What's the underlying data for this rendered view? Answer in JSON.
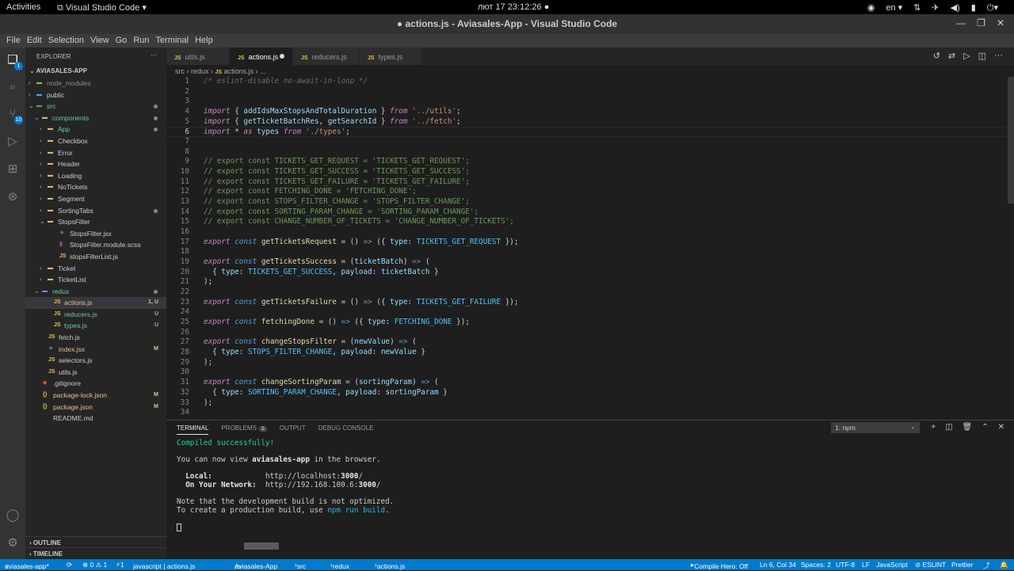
{
  "topbar": {
    "activities": "Activities",
    "app": "Visual Studio Code",
    "clock": "лют 17  23:12:26",
    "lang": "en"
  },
  "window": {
    "title": "● actions.js - Aviasales-App - Visual Studio Code"
  },
  "menu": [
    "File",
    "Edit",
    "Selection",
    "View",
    "Go",
    "Run",
    "Terminal",
    "Help"
  ],
  "activity": {
    "scm_badge": "1",
    "git_badge": "10"
  },
  "explorer": {
    "heading": "EXPLORER",
    "root": "AVIASALES-APP",
    "rows": [
      {
        "label": "node_modules",
        "depth": 1,
        "type": "folder-node",
        "open": false,
        "color": "#8c8c8c"
      },
      {
        "label": "public",
        "depth": 1,
        "type": "folder-public",
        "open": false,
        "color": "#cccccc"
      },
      {
        "label": "src",
        "depth": 1,
        "type": "folder-src",
        "open": true,
        "color": "#73c991",
        "dot": true
      },
      {
        "label": "components",
        "depth": 2,
        "type": "folder",
        "open": true,
        "color": "#73c991",
        "dot": true
      },
      {
        "label": "App",
        "depth": 3,
        "type": "folder",
        "open": false,
        "color": "#73c991",
        "dot": true
      },
      {
        "label": "Checkbox",
        "depth": 3,
        "type": "folder",
        "open": false,
        "color": "#cccccc"
      },
      {
        "label": "Error",
        "depth": 3,
        "type": "folder",
        "open": false,
        "color": "#cccccc"
      },
      {
        "label": "Header",
        "depth": 3,
        "type": "folder",
        "open": false,
        "color": "#cccccc"
      },
      {
        "label": "Loading",
        "depth": 3,
        "type": "folder",
        "open": false,
        "color": "#cccccc"
      },
      {
        "label": "NoTickets",
        "depth": 3,
        "type": "folder",
        "open": false,
        "color": "#cccccc"
      },
      {
        "label": "Segment",
        "depth": 3,
        "type": "folder",
        "open": false,
        "color": "#cccccc"
      },
      {
        "label": "SortingTabs",
        "depth": 3,
        "type": "folder",
        "open": false,
        "color": "#cccccc",
        "dot": true
      },
      {
        "label": "StopsFilter",
        "depth": 3,
        "type": "folder",
        "open": true,
        "color": "#cccccc"
      },
      {
        "label": "StopsFilter.jsx",
        "depth": 4,
        "type": "react",
        "color": "#cccccc"
      },
      {
        "label": "StopsFilter.module.scss",
        "depth": 4,
        "type": "scss",
        "color": "#cccccc"
      },
      {
        "label": "stopsFilterList.js",
        "depth": 4,
        "type": "js",
        "color": "#cccccc"
      },
      {
        "label": "Ticket",
        "depth": 3,
        "type": "folder",
        "open": false,
        "color": "#cccccc"
      },
      {
        "label": "TicketList",
        "depth": 3,
        "type": "folder",
        "open": false,
        "color": "#cccccc"
      },
      {
        "label": "redux",
        "depth": 2,
        "type": "folder-redux",
        "open": true,
        "color": "#73c991",
        "dot": true
      },
      {
        "label": "actions.js",
        "depth": 3,
        "type": "js",
        "color": "#e2c08d",
        "status": "1, U",
        "selected": true
      },
      {
        "label": "reducers.js",
        "depth": 3,
        "type": "js",
        "color": "#73c991",
        "status": "U"
      },
      {
        "label": "types.js",
        "depth": 3,
        "type": "js",
        "color": "#73c991",
        "status": "U"
      },
      {
        "label": "fetch.js",
        "depth": 2,
        "type": "js",
        "color": "#cccccc"
      },
      {
        "label": "index.jsx",
        "depth": 2,
        "type": "react",
        "color": "#e2c08d",
        "status": "M"
      },
      {
        "label": "selectors.js",
        "depth": 2,
        "type": "js",
        "color": "#cccccc"
      },
      {
        "label": "utils.js",
        "depth": 2,
        "type": "js",
        "color": "#cccccc"
      },
      {
        "label": ".gitignore",
        "depth": 1,
        "type": "git",
        "color": "#cccccc"
      },
      {
        "label": "package-lock.json",
        "depth": 1,
        "type": "json",
        "color": "#e2c08d",
        "status": "M"
      },
      {
        "label": "package.json",
        "depth": 1,
        "type": "json",
        "color": "#e2c08d",
        "status": "M"
      },
      {
        "label": "README.md",
        "depth": 1,
        "type": "md",
        "color": "#cccccc"
      }
    ],
    "outline": "OUTLINE",
    "timeline": "TIMELINE"
  },
  "tabs": [
    {
      "label": "utils.js",
      "active": false,
      "modified": false
    },
    {
      "label": "actions.js",
      "active": true,
      "modified": true
    },
    {
      "label": "reducers.js",
      "active": false,
      "modified": false
    },
    {
      "label": "types.js",
      "active": false,
      "modified": false
    }
  ],
  "breadcrumb": {
    "p1": "src",
    "p2": "redux",
    "p3": "actions.js",
    "p4": "..."
  },
  "code": [
    [
      [
        "cmt",
        "/* eslint-disable no-await-in-loop */"
      ]
    ],
    [],
    [],
    [
      [
        "kw",
        "import"
      ],
      [
        "op",
        " { "
      ],
      [
        "vr",
        "addIdsMaxStopsAndTotalDuration"
      ],
      [
        "op",
        " } "
      ],
      [
        "kw",
        "from"
      ],
      [
        "op",
        " "
      ],
      [
        "st",
        "'../utils'"
      ],
      [
        "op",
        ";"
      ]
    ],
    [
      [
        "kw",
        "import"
      ],
      [
        "op",
        " { "
      ],
      [
        "vr",
        "getTicketBatchRes"
      ],
      [
        "op",
        ", "
      ],
      [
        "vr",
        "getSearchId"
      ],
      [
        "op",
        " } "
      ],
      [
        "kw",
        "from"
      ],
      [
        "op",
        " "
      ],
      [
        "st",
        "'../fetch'"
      ],
      [
        "op",
        ";"
      ]
    ],
    [
      [
        "kw",
        "import"
      ],
      [
        "op",
        " * "
      ],
      [
        "kw",
        "as"
      ],
      [
        "op",
        " "
      ],
      [
        "vr",
        "types"
      ],
      [
        "op",
        " "
      ],
      [
        "kw",
        "from"
      ],
      [
        "op",
        " "
      ],
      [
        "st",
        "'./types'"
      ],
      [
        "op",
        ";"
      ]
    ],
    [],
    [],
    [
      [
        "cm",
        "// export const TICKETS_GET_REQUEST = 'TICKETS_GET_REQUEST';"
      ]
    ],
    [
      [
        "cm",
        "// export const TICKETS_GET_SUCCESS = 'TICKETS_GET_SUCCESS';"
      ]
    ],
    [
      [
        "cm",
        "// export const TICKETS_GET_FAILURE = 'TICKETS_GET_FAILURE';"
      ]
    ],
    [
      [
        "cm",
        "// export const FETCHING_DONE = 'FETCHING_DONE';"
      ]
    ],
    [
      [
        "cm",
        "// export const STOPS_FILTER_CHANGE = 'STOPS_FILTER_CHANGE';"
      ]
    ],
    [
      [
        "cm",
        "// export const SORTING_PARAM_CHANGE = 'SORTING_PARAM_CHANGE';"
      ]
    ],
    [
      [
        "cm",
        "// export const CHANGE_NUMBER_OF_TICKETS = 'CHANGE_NUMBER_OF_TICKETS';"
      ]
    ],
    [],
    [
      [
        "kw",
        "export"
      ],
      [
        "op",
        " "
      ],
      [
        "ky",
        "const"
      ],
      [
        "op",
        " "
      ],
      [
        "fn",
        "getTicketsRequest"
      ],
      [
        "op",
        " = () "
      ],
      [
        "ky",
        "=>"
      ],
      [
        "op",
        " ({ "
      ],
      [
        "vr",
        "type"
      ],
      [
        "op",
        ": "
      ],
      [
        "cn",
        "TICKETS_GET_REQUEST"
      ],
      [
        "op",
        " });"
      ]
    ],
    [],
    [
      [
        "kw",
        "export"
      ],
      [
        "op",
        " "
      ],
      [
        "ky",
        "const"
      ],
      [
        "op",
        " "
      ],
      [
        "fn",
        "getTicketsSuccess"
      ],
      [
        "op",
        " = ("
      ],
      [
        "vr",
        "ticketBatch"
      ],
      [
        "op",
        ") "
      ],
      [
        "ky",
        "=>"
      ],
      [
        "op",
        " ("
      ]
    ],
    [
      [
        "op",
        "  { "
      ],
      [
        "vr",
        "type"
      ],
      [
        "op",
        ": "
      ],
      [
        "cn",
        "TICKETS_GET_SUCCESS"
      ],
      [
        "op",
        ", "
      ],
      [
        "vr",
        "payload"
      ],
      [
        "op",
        ": "
      ],
      [
        "vr",
        "ticketBatch"
      ],
      [
        "op",
        " }"
      ]
    ],
    [
      [
        "op",
        ");"
      ]
    ],
    [],
    [
      [
        "kw",
        "export"
      ],
      [
        "op",
        " "
      ],
      [
        "ky",
        "const"
      ],
      [
        "op",
        " "
      ],
      [
        "fn",
        "getTicketsFailure"
      ],
      [
        "op",
        " = () "
      ],
      [
        "ky",
        "=>"
      ],
      [
        "op",
        " ({ "
      ],
      [
        "vr",
        "type"
      ],
      [
        "op",
        ": "
      ],
      [
        "cn",
        "TICKETS_GET_FAILURE"
      ],
      [
        "op",
        " });"
      ]
    ],
    [],
    [
      [
        "kw",
        "export"
      ],
      [
        "op",
        " "
      ],
      [
        "ky",
        "const"
      ],
      [
        "op",
        " "
      ],
      [
        "fn",
        "fetchingDone"
      ],
      [
        "op",
        " = () "
      ],
      [
        "ky",
        "=>"
      ],
      [
        "op",
        " ({ "
      ],
      [
        "vr",
        "type"
      ],
      [
        "op",
        ": "
      ],
      [
        "cn",
        "FETCHING_DONE"
      ],
      [
        "op",
        " });"
      ]
    ],
    [],
    [
      [
        "kw",
        "export"
      ],
      [
        "op",
        " "
      ],
      [
        "ky",
        "const"
      ],
      [
        "op",
        " "
      ],
      [
        "fn",
        "changeStopsFilter"
      ],
      [
        "op",
        " = ("
      ],
      [
        "vr",
        "newValue"
      ],
      [
        "op",
        ") "
      ],
      [
        "ky",
        "=>"
      ],
      [
        "op",
        " ("
      ]
    ],
    [
      [
        "op",
        "  { "
      ],
      [
        "vr",
        "type"
      ],
      [
        "op",
        ": "
      ],
      [
        "cn",
        "STOPS_FILTER_CHANGE"
      ],
      [
        "op",
        ", "
      ],
      [
        "vr",
        "payload"
      ],
      [
        "op",
        ": "
      ],
      [
        "vr",
        "newValue"
      ],
      [
        "op",
        " }"
      ]
    ],
    [
      [
        "op",
        ");"
      ]
    ],
    [],
    [
      [
        "kw",
        "export"
      ],
      [
        "op",
        " "
      ],
      [
        "ky",
        "const"
      ],
      [
        "op",
        " "
      ],
      [
        "fn",
        "changeSortingParam"
      ],
      [
        "op",
        " = ("
      ],
      [
        "vr",
        "sortingParam"
      ],
      [
        "op",
        ") "
      ],
      [
        "ky",
        "=>"
      ],
      [
        "op",
        " ("
      ]
    ],
    [
      [
        "op",
        "  { "
      ],
      [
        "vr",
        "type"
      ],
      [
        "op",
        ": "
      ],
      [
        "cn",
        "SORTING_PARAM_CHANGE"
      ],
      [
        "op",
        ", "
      ],
      [
        "vr",
        "payload"
      ],
      [
        "op",
        ": "
      ],
      [
        "vr",
        "sortingParam"
      ],
      [
        "op",
        " }"
      ]
    ],
    [
      [
        "op",
        ");"
      ]
    ],
    []
  ],
  "current_line": 6,
  "panel": {
    "tabs": [
      "TERMINAL",
      "PROBLEMS",
      "OUTPUT",
      "DEBUG CONSOLE"
    ],
    "problems_count": "1",
    "terminal_select": "1: npm",
    "lines": [
      [
        [
          "g",
          "Compiled successfully!"
        ]
      ],
      [],
      [
        [
          "n",
          "You can now view "
        ],
        [
          "b",
          "aviasales-app"
        ],
        [
          "n",
          " in the browser."
        ]
      ],
      [],
      [
        [
          "b",
          "  Local:"
        ],
        [
          "n",
          "            http://localhost:"
        ],
        [
          "b",
          "3000"
        ],
        [
          "n",
          "/"
        ]
      ],
      [
        [
          "b",
          "  On Your Network:"
        ],
        [
          "n",
          "  http://192.168.100.6:"
        ],
        [
          "b",
          "3000"
        ],
        [
          "n",
          "/"
        ]
      ],
      [],
      [
        [
          "n",
          "Note that the development build is not optimized."
        ]
      ],
      [
        [
          "n",
          "To create a production build, use "
        ],
        [
          "c",
          "npm run build"
        ],
        [
          "n",
          "."
        ]
      ],
      [],
      [
        [
          "cursor",
          ""
        ]
      ]
    ]
  },
  "status": {
    "branch": "aviasales-app*",
    "errors": "⊗ 0 ⚠ 1",
    "git": "⚡1",
    "lang_crumb": "javascript | actions.js",
    "project": "Aviasales-App",
    "crumb1": "src",
    "crumb2": "redux",
    "crumb3": "actions.js",
    "compile_hero": "Compile Hero: Off",
    "position": "Ln 6, Col 34",
    "spaces": "Spaces: 2",
    "encoding": "UTF-8",
    "eol": "LF",
    "language": "JavaScript",
    "eslint": "⊘ ESLINT",
    "prettier": "Prettier"
  }
}
